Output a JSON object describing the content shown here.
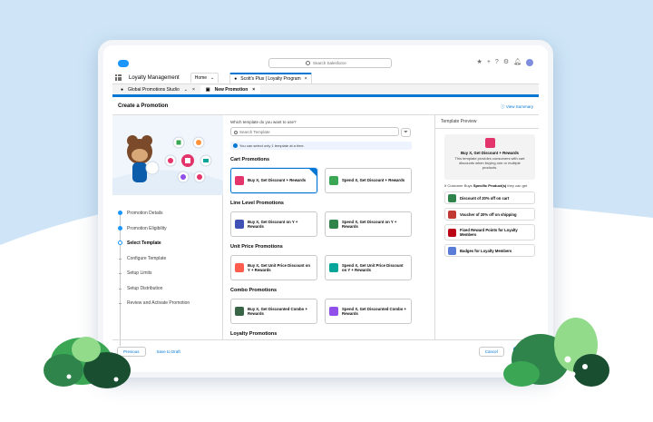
{
  "header": {
    "search_placeholder": "Search Salesforce",
    "icons": [
      "favorites-icon",
      "add-icon",
      "help-icon",
      "setup-icon",
      "notifications-icon",
      "avatar"
    ]
  },
  "nav": {
    "app_name": "Loyalty Management",
    "tabs": [
      {
        "label": "Home",
        "active": false
      },
      {
        "label": "Scott's Plus | Loyalty Program",
        "active": true
      }
    ]
  },
  "subtabs": [
    {
      "label": "Global Promotions Studio",
      "active": false
    },
    {
      "label": "New Promotion",
      "active": true
    }
  ],
  "page": {
    "title": "Create a Promotion",
    "view_summary": "View Summary"
  },
  "steps": [
    {
      "label": "Promotion Details",
      "state": "done"
    },
    {
      "label": "Promotion Eligibility",
      "state": "done"
    },
    {
      "label": "Select Template",
      "state": "current"
    },
    {
      "label": "Configure Template",
      "state": "future"
    },
    {
      "label": "Setup Limits",
      "state": "future"
    },
    {
      "label": "Setup Distribution",
      "state": "future"
    },
    {
      "label": "Review and Activate Promotion",
      "state": "future"
    }
  ],
  "templates": {
    "question": "Which template do you want to use?",
    "search_placeholder": "Search Template",
    "info": "You can select only 1 template at a time.",
    "sections": [
      {
        "title": "Cart Promotions",
        "cards": [
          {
            "label": "Buy X, Get Discount + Rewards",
            "color": "#e3346b",
            "selected": true
          },
          {
            "label": "Spend X, Get Discount + Rewards",
            "color": "#3ba755",
            "selected": false
          }
        ]
      },
      {
        "title": "Line Level Promotions",
        "cards": [
          {
            "label": "Buy X, Get Discount on Y + Rewards",
            "color": "#3f51b5",
            "selected": false
          },
          {
            "label": "Spend X, Get Discount on Y + Rewards",
            "color": "#2e844a",
            "selected": false
          }
        ]
      },
      {
        "title": "Unit Price Promotions",
        "cards": [
          {
            "label": "Buy X, Get Unit Price Discount on Y + Rewards",
            "color": "#fe5c4c",
            "selected": false
          },
          {
            "label": "Spend X, Get Unit Price Discount on Y + Rewards",
            "color": "#06a59a",
            "selected": false
          }
        ]
      },
      {
        "title": "Combo Promotions",
        "cards": [
          {
            "label": "Buy X, Get Discounted Combo + Rewards",
            "color": "#396547",
            "selected": false
          },
          {
            "label": "Spend X, Get Discounted Combo + Rewards",
            "color": "#9050e9",
            "selected": false
          }
        ]
      },
      {
        "title": "Loyalty Promotions",
        "cards": []
      }
    ]
  },
  "preview": {
    "title": "Template Preview",
    "card_title": "Buy X, Get Discount + Rewards",
    "card_desc": "This template provides consumers with cart discounts when buying one or multiple products.",
    "note_prefix": "If Customer Buys",
    "note_bold": "Specific Product(s)",
    "note_suffix": "they can get",
    "items": [
      {
        "label": "Discount of 20% off on cart",
        "color": "#2e844a"
      },
      {
        "label": "Voucher of 20% off on shipping",
        "color": "#c23934"
      },
      {
        "label": "Fixed Reward Points for Loyalty Members",
        "color": "#ba0517"
      },
      {
        "label": "Badges for Loyalty Members",
        "color": "#5a7bd6"
      }
    ]
  },
  "footer": {
    "previous": "Previous",
    "save_draft": "Save to Draft",
    "cancel": "Cancel",
    "next": "Next"
  }
}
